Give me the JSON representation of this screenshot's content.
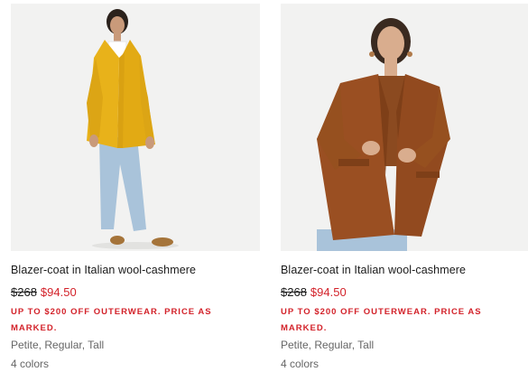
{
  "products": [
    {
      "name": "Blazer-coat in Italian wool-cashmere",
      "original_price": "$268",
      "sale_price": "$94.50",
      "promo": "UP TO $200 OFF OUTERWEAR. PRICE AS MARKED.",
      "sizes": "Petite, Regular, Tall",
      "colors": "4 colors",
      "image_subject": "model-in-yellow-coat",
      "coat_color": "#e8b21a"
    },
    {
      "name": "Blazer-coat in Italian wool-cashmere",
      "original_price": "$268",
      "sale_price": "$94.50",
      "promo": "UP TO $200 OFF OUTERWEAR. PRICE AS MARKED.",
      "sizes": "Petite, Regular, Tall",
      "colors": "4 colors",
      "image_subject": "model-in-brown-coat",
      "coat_color": "#9a4f22"
    }
  ],
  "colors": {
    "sale_red": "#d3222a",
    "muted_text": "#666666",
    "photo_bg": "#f2f2f1"
  }
}
